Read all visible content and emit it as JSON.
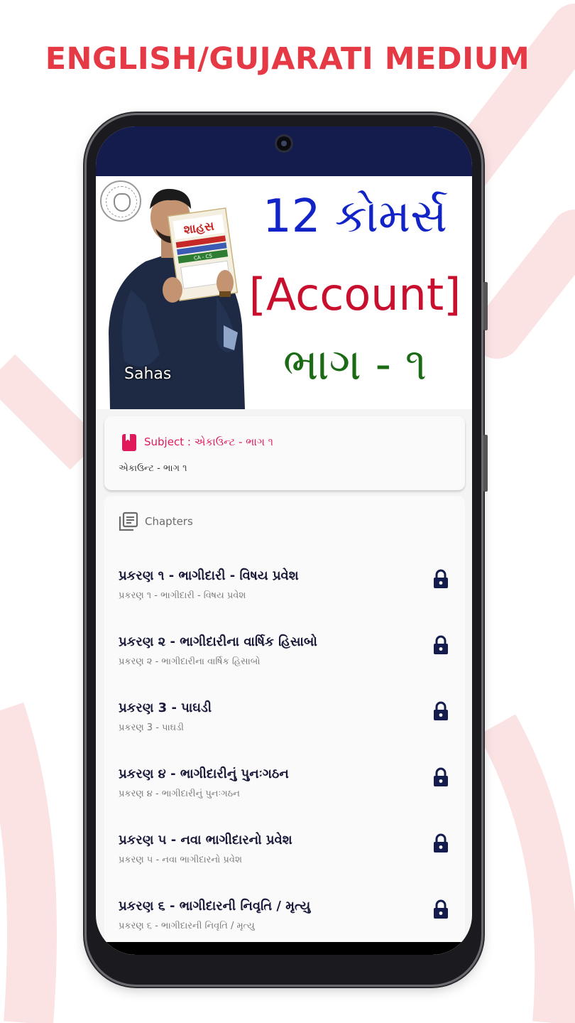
{
  "promo": {
    "headline": "ENGLISH/GUJARATI MEDIUM",
    "accent_color": "#e53945"
  },
  "banner": {
    "line1": "12 કોમર્સ",
    "line2": "[Account]",
    "line3": "ભાગ - ૧",
    "person_name": "Sahas",
    "book_title": "શાહસ",
    "book_subtitle": "CA - CS",
    "line1_color": "#1224c8",
    "line2_color": "#c8102e",
    "line3_color": "#1b6b16"
  },
  "subject": {
    "icon": "bookmark-icon",
    "title": "Subject : એકાઉન્ટ - ભાગ ૧",
    "description": "એકાઉન્ટ - ભાગ ૧",
    "accent_color": "#e0195b"
  },
  "chapters": {
    "icon": "library-books-icon",
    "label": "Chapters",
    "items": [
      {
        "title": "પ્રકરણ ૧ - ભાગીદારી - વિષય પ્રવેશ",
        "subtitle": "પ્રકરણ ૧ - ભાગીદારી - વિષય પ્રવેશ",
        "locked": true
      },
      {
        "title": "પ્રકરણ ૨ - ભાગીદારીના વાર્ષિક હિસાબો",
        "subtitle": "પ્રકરણ ૨ - ભાગીદારીના વાર્ષિક હિસાબો",
        "locked": true
      },
      {
        "title": "પ્રકરણ 3 - પાઘડી",
        "subtitle": "પ્રકરણ 3 - પાઘડી",
        "locked": true
      },
      {
        "title": "પ્રકરણ ૪ - ભાગીદારીનું પુનઃગઠન",
        "subtitle": "પ્રકરણ ૪ - ભાગીદારીનું પુનઃગઠન",
        "locked": true
      },
      {
        "title": "પ્રકરણ ૫ - નવા ભાગીદારનો પ્રવેશ",
        "subtitle": "પ્રકરણ ૫ - નવા ભાગીદારનો પ્રવેશ",
        "locked": true
      },
      {
        "title": "પ્રકરણ ૬ - ભાગીદારની નિવૃતિ / મૃત્યુ",
        "subtitle": "પ્રકરણ ૬ - ભાગીદારની નિવૃતિ / મૃત્યુ",
        "locked": true
      }
    ]
  },
  "theme": {
    "status_bar_color": "#141c4d",
    "lock_color": "#141c4d"
  }
}
